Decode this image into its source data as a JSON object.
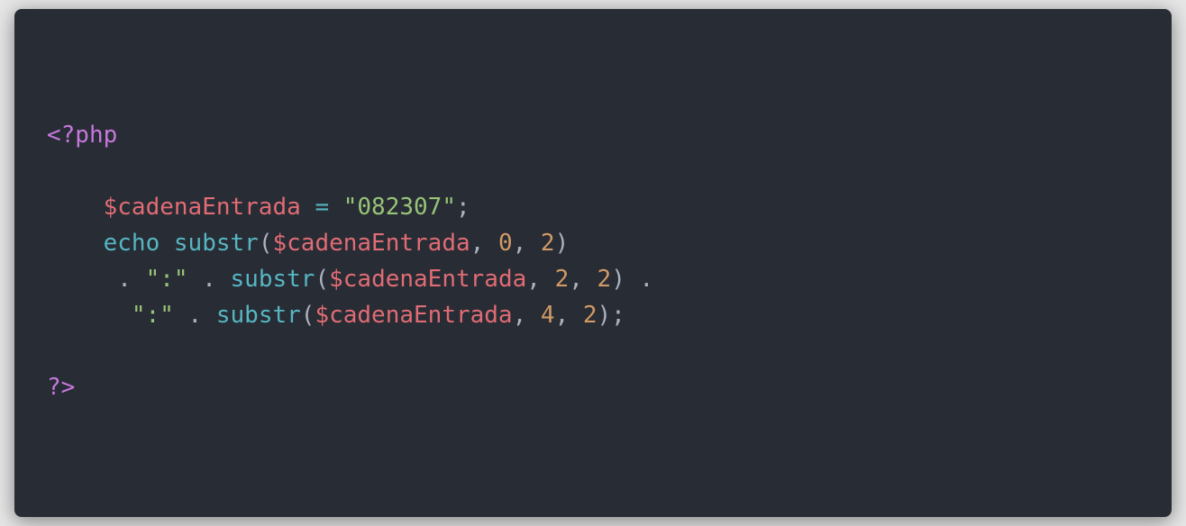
{
  "colors": {
    "background": "#282c34",
    "tag": "#c678dd",
    "variable": "#e06c75",
    "operator": "#56b6c2",
    "string": "#98c379",
    "number": "#d19a66",
    "function": "#56b6c2",
    "punctuation": "#abb2bf"
  },
  "code": {
    "open_tag": "<?php",
    "line1": {
      "indent": "    ",
      "var": "$cadenaEntrada",
      "sp1": " ",
      "op": "=",
      "sp2": " ",
      "str": "\"082307\"",
      "end": ";"
    },
    "line2": {
      "indent": "    ",
      "kw": "echo",
      "sp1": " ",
      "fn": "substr",
      "p1": "(",
      "var": "$cadenaEntrada",
      "c1": ", ",
      "n1": "0",
      "c2": ", ",
      "n2": "2",
      "p2": ")"
    },
    "line3": {
      "indent": "     ",
      "dot1": ". ",
      "str": "\":\"",
      "dot2": " . ",
      "fn": "substr",
      "p1": "(",
      "var": "$cadenaEntrada",
      "c1": ", ",
      "n1": "2",
      "c2": ", ",
      "n2": "2",
      "p2": ")",
      "dot3": " ."
    },
    "line4": {
      "indent": "      ",
      "str": "\":\"",
      "dot1": " . ",
      "fn": "substr",
      "p1": "(",
      "var": "$cadenaEntrada",
      "c1": ", ",
      "n1": "4",
      "c2": ", ",
      "n2": "2",
      "p2": ");"
    },
    "close_tag": "?>"
  }
}
